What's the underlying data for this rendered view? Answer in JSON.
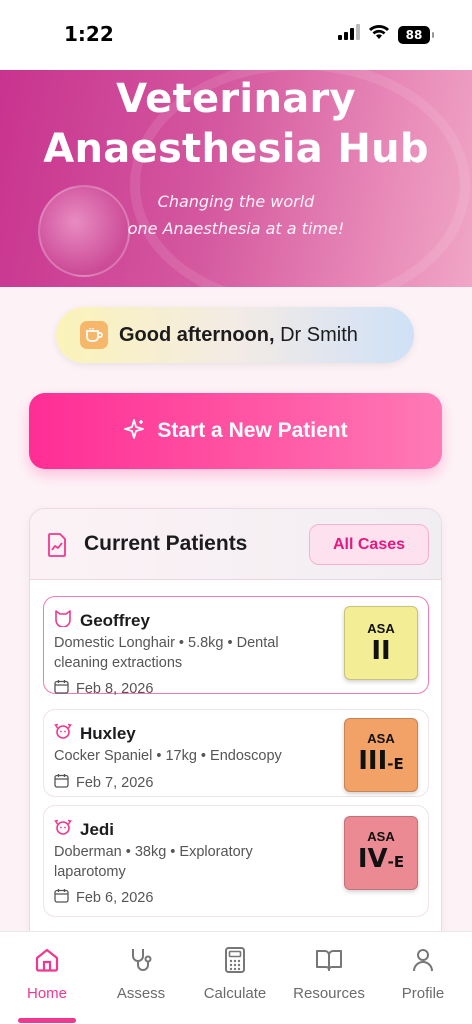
{
  "status_bar": {
    "time": "1:22",
    "battery": "88"
  },
  "hero": {
    "title_line1": "Veterinary",
    "title_line2": "Anaesthesia Hub",
    "subtitle_line1": "Changing the world",
    "subtitle_line2": "one Anaesthesia at a time!"
  },
  "greeting": {
    "salutation": "Good afternoon,",
    "name": "Dr Smith"
  },
  "start_button": {
    "label": "Start a New Patient"
  },
  "patients_card": {
    "title": "Current Patients",
    "all_cases_label": "All Cases",
    "patients": [
      {
        "name": "Geoffrey",
        "species_icon": "cat-icon",
        "details": "Domestic Longhair • 5.8kg • Dental cleaning extractions",
        "date": "Feb 8, 2026",
        "asa_label": "ASA",
        "asa_class": "II",
        "asa_suffix": "",
        "asa_color": "#f3ee96"
      },
      {
        "name": "Huxley",
        "species_icon": "dog-icon",
        "details": "Cocker Spaniel • 17kg • Endoscopy",
        "date": "Feb 7, 2026",
        "asa_label": "ASA",
        "asa_class": "III",
        "asa_suffix": "-E",
        "asa_color": "#f2a167"
      },
      {
        "name": "Jedi",
        "species_icon": "dog-icon",
        "details": "Doberman • 38kg • Exploratory laparotomy",
        "date": "Feb 6, 2026",
        "asa_label": "ASA",
        "asa_class": "IV",
        "asa_suffix": "-E",
        "asa_color": "#ec8a93"
      }
    ]
  },
  "bottom_nav": {
    "items": [
      {
        "label": "Home",
        "icon": "home-icon",
        "active": true
      },
      {
        "label": "Assess",
        "icon": "stethoscope-icon",
        "active": false
      },
      {
        "label": "Calculate",
        "icon": "calculator-icon",
        "active": false
      },
      {
        "label": "Resources",
        "icon": "book-icon",
        "active": false
      },
      {
        "label": "Profile",
        "icon": "user-icon",
        "active": false
      }
    ]
  },
  "colors": {
    "accent": "#f2378f",
    "button_gradient_start": "#ff2d95",
    "hero_start": "#c8338f"
  }
}
